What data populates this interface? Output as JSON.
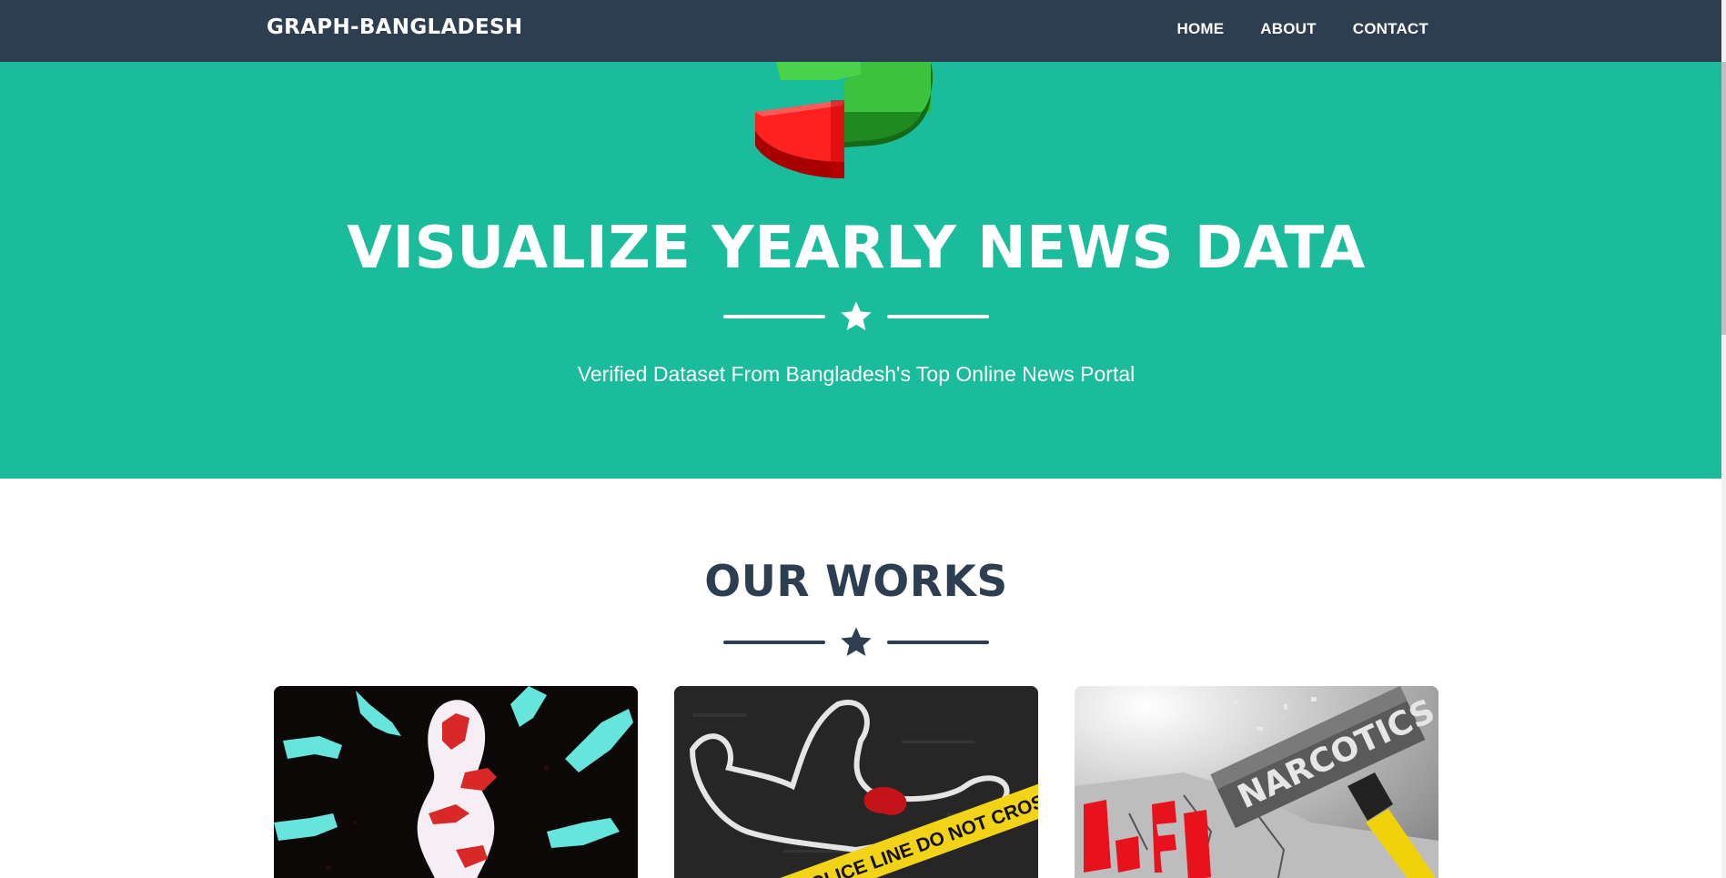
{
  "navbar": {
    "brand": "GRAPH-BANGLADESH",
    "links": [
      "HOME",
      "ABOUT",
      "CONTACT"
    ]
  },
  "hero": {
    "title": "VISUALIZE YEARLY NEWS DATA",
    "subtitle": "Verified Dataset From Bangladesh's Top Online News Portal",
    "logo_icon": "pie-chart-icon"
  },
  "works": {
    "title": "OUR WORKS",
    "cards": [
      {
        "image": "hands-silhouette-image"
      },
      {
        "image": "crime-scene-image",
        "tape_text": "POLICE LINE DO NOT CROSS"
      },
      {
        "image": "narcotics-hammer-image",
        "hammer_text": "NARCOTICS",
        "word_text": "LIFE"
      }
    ]
  },
  "colors": {
    "navbar": "#2c3e50",
    "hero": "#1abc9c",
    "heading": "#2c3e50"
  }
}
